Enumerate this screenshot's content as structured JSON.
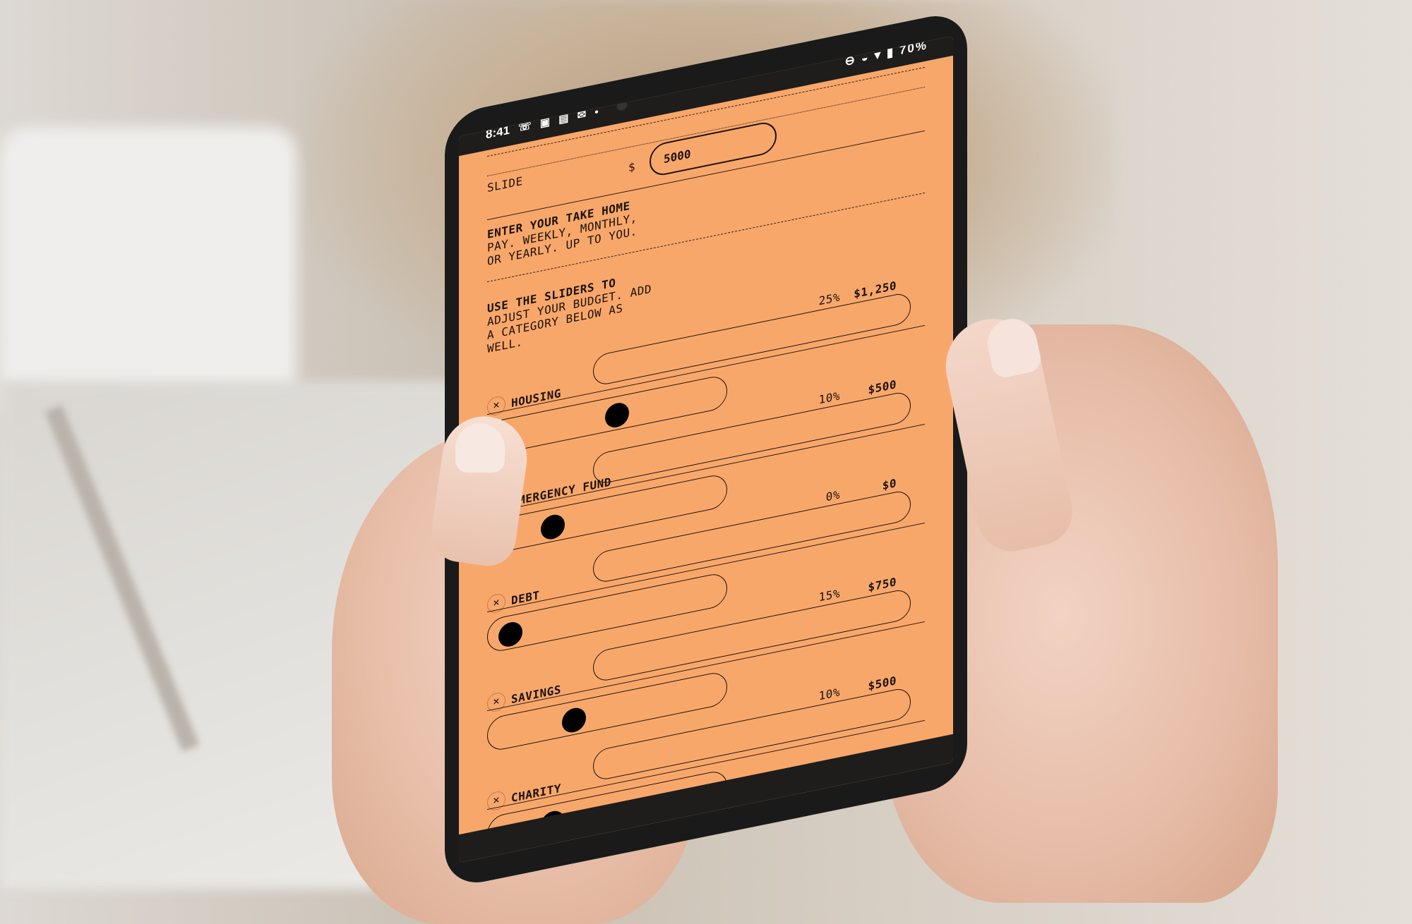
{
  "status_bar": {
    "time": "8:41",
    "left_icons": "☏ ▣ ▤ ✉ •",
    "right_icons": "⊖ ◒ ▾ ▮",
    "battery": "70%"
  },
  "app": {
    "title": "SLIDE",
    "income_prompt_line1": "ENTER YOUR TAKE HOME",
    "income_prompt_line2": "PAY. WEEKLY, MONTHLY,",
    "income_prompt_line3": "OR YEARLY. UP TO YOU.",
    "currency_symbol": "$",
    "income_value": "5000",
    "sliders_prompt_line1": "USE THE SLIDERS TO",
    "sliders_prompt_line2": "ADJUST YOUR BUDGET. ADD",
    "sliders_prompt_line3": "A CATEGORY BELOW AS",
    "sliders_prompt_line4": "WELL."
  },
  "categories": [
    {
      "name": "HOUSING",
      "percent": "25%",
      "amount": "$1,250",
      "remove": "×",
      "slider_fraction": 0.25
    },
    {
      "name": "EMERGENCY FUND",
      "percent": "10%",
      "amount": "$500",
      "remove": "×",
      "slider_fraction": 0.1
    },
    {
      "name": "DEBT",
      "percent": "0%",
      "amount": "$0",
      "remove": "×",
      "slider_fraction": 0.0
    },
    {
      "name": "SAVINGS",
      "percent": "15%",
      "amount": "$750",
      "remove": "×",
      "slider_fraction": 0.15
    },
    {
      "name": "CHARITY",
      "percent": "10%",
      "amount": "$500",
      "remove": "×",
      "slider_fraction": 0.1
    }
  ],
  "colors": {
    "screen_background": "#f8a76b",
    "ink": "#1c120b",
    "knob": "#000000"
  }
}
